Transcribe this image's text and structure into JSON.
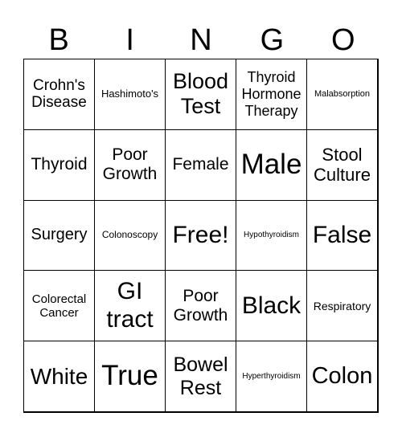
{
  "header": [
    "B",
    "I",
    "N",
    "G",
    "O"
  ],
  "cells": [
    "Crohn's Disease",
    "Hashimoto's",
    "Blood Test",
    "Thyroid Hormone Therapy",
    "Malabsorption",
    "Thyroid",
    "Poor Growth",
    "Female",
    "Male",
    "Stool Culture",
    "Surgery",
    "Colonoscopy",
    "Free!",
    "Hypothyroidism",
    "False",
    "Colorectal Cancer",
    "GI tract",
    "Poor Growth",
    "Black",
    "Respiratory",
    "White",
    "True",
    "Bowel Rest",
    "Hyperthyroidism",
    "Colon"
  ]
}
